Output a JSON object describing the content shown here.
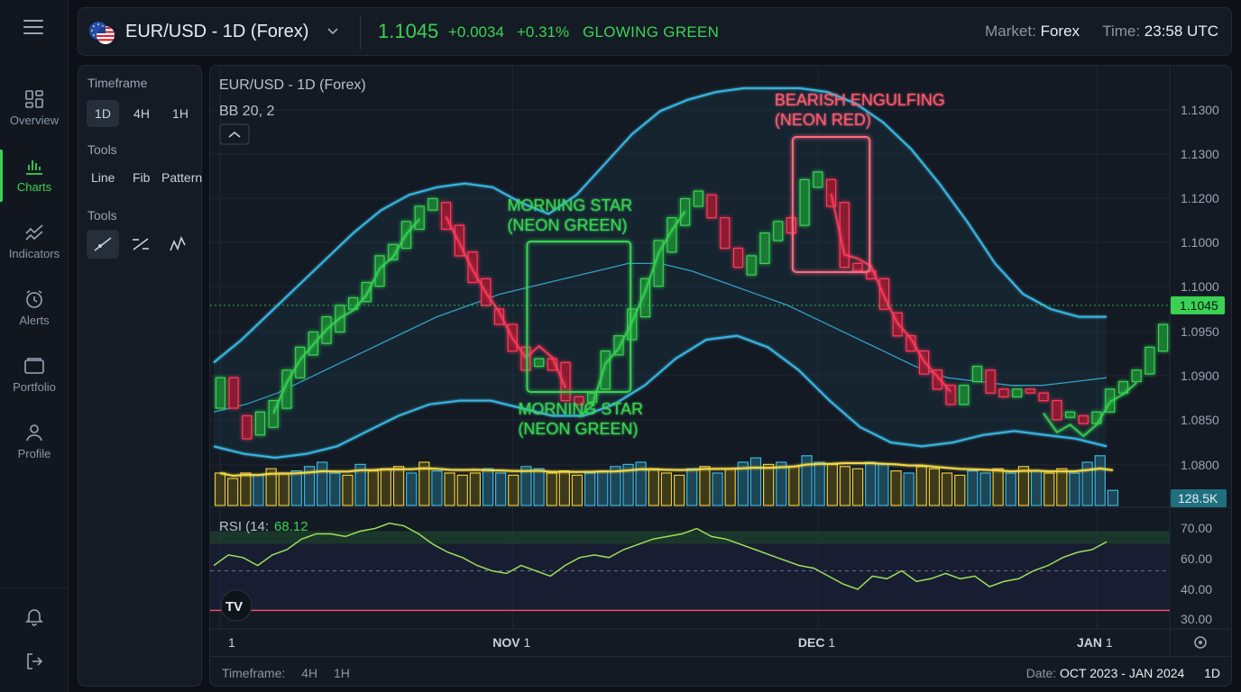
{
  "nav": {
    "items": [
      {
        "id": "overview",
        "label": "Overview",
        "icon": "layout-grid-icon"
      },
      {
        "id": "charts",
        "label": "Charts",
        "icon": "bar-chart-icon"
      },
      {
        "id": "indicators",
        "label": "Indicators",
        "icon": "trend-lines-icon"
      },
      {
        "id": "alerts",
        "label": "Alerts",
        "icon": "alarm-clock-icon"
      },
      {
        "id": "portfolio",
        "label": "Portfolio",
        "icon": "folder-icon"
      },
      {
        "id": "profile",
        "label": "Profile",
        "icon": "user-icon"
      }
    ],
    "active": "charts"
  },
  "header": {
    "pair": "EUR/USD - 1D (Forex)",
    "price": "1.1045",
    "change": "+0.0034",
    "change_pct": "+0.31%",
    "tag": "GLOWING GREEN",
    "market_label": "Market:",
    "market_value": "Forex",
    "time_label": "Time:",
    "time_value": "23:58 UTC"
  },
  "tools_panel": {
    "timeframe_label": "Timeframe",
    "timeframes": [
      "1D",
      "4H",
      "1H"
    ],
    "active_timeframe": "1D",
    "tools_label": "Tools",
    "tools": [
      "Line",
      "Fib",
      "Pattern"
    ],
    "tools2_label": "Tools",
    "drawing_tools": [
      "trendline-icon",
      "ray-icon",
      "path-icon"
    ]
  },
  "chart_header": {
    "title": "EUR/USD - 1D (Forex)",
    "indicator": "BB 20, 2"
  },
  "footer": {
    "timeframe_label": "Timeframe:",
    "timeframe_options": [
      "4H",
      "1H"
    ],
    "date_label": "Date:",
    "date_value": "OCT 2023 - JAN 2024",
    "interval": "1D"
  },
  "colors": {
    "up": "#39d353",
    "down": "#ff3b5c",
    "band": "#38b6e0",
    "volume_up": "#38b6e0",
    "volume_down": "#e8c93a",
    "rsi": "#9be05a",
    "accent": "#39d353"
  },
  "chart_data": [
    {
      "type": "candlestick",
      "title": "EUR/USD - 1D (Forex)",
      "subtitle": "BB 20, 2",
      "x_ticks": [
        {
          "label": "1",
          "index": 0
        },
        {
          "label": "NOV 1",
          "index": 22
        },
        {
          "label": "DEC 1",
          "index": 45
        },
        {
          "label": "JAN 1",
          "index": 66
        }
      ],
      "y_ticks": [
        1.13,
        1.13,
        1.12,
        1.1,
        1.1,
        1.095,
        1.09,
        1.085,
        1.08
      ],
      "y_ticks_display": [
        "1.1300",
        "1.1300",
        "1.1200",
        "1.1000",
        "1.1000",
        "1.0950",
        "1.0900",
        "1.0850",
        "1.0800"
      ],
      "ylim": [
        1.078,
        1.135
      ],
      "last_price_label": "1.1045",
      "volume_label": "128.5K",
      "candles": [
        [
          1.091,
          1.095,
          1.0895,
          1.096
        ],
        [
          1.095,
          1.091,
          1.09,
          1.096
        ],
        [
          1.09,
          1.087,
          1.086,
          1.091
        ],
        [
          1.0875,
          1.0905,
          1.0865,
          1.0915
        ],
        [
          1.0885,
          1.092,
          1.087,
          1.093
        ],
        [
          1.091,
          1.096,
          1.09,
          1.097
        ],
        [
          1.095,
          1.099,
          1.094,
          1.1
        ],
        [
          1.098,
          1.101,
          1.096,
          1.102
        ],
        [
          1.0995,
          1.103,
          1.098,
          1.104
        ],
        [
          1.101,
          1.1045,
          1.0995,
          1.105
        ],
        [
          1.104,
          1.1055,
          1.102,
          1.1065
        ],
        [
          1.105,
          1.1075,
          1.1035,
          1.1085
        ],
        [
          1.107,
          1.111,
          1.106,
          1.112
        ],
        [
          1.1105,
          1.1125,
          1.109,
          1.114
        ],
        [
          1.112,
          1.1155,
          1.11,
          1.1165
        ],
        [
          1.1145,
          1.1175,
          1.113,
          1.1205
        ],
        [
          1.117,
          1.1185,
          1.115,
          1.1195
        ],
        [
          1.118,
          1.1145,
          1.112,
          1.119
        ],
        [
          1.115,
          1.111,
          1.11,
          1.116
        ],
        [
          1.1115,
          1.1075,
          1.106,
          1.112
        ],
        [
          1.108,
          1.1045,
          1.103,
          1.109
        ],
        [
          1.104,
          1.102,
          1.101,
          1.1055
        ],
        [
          1.102,
          1.0985,
          1.097,
          1.103
        ],
        [
          1.099,
          1.096,
          1.0935,
          1.1
        ],
        [
          1.0965,
          1.0975,
          1.094,
          1.099
        ],
        [
          1.0975,
          1.096,
          1.0945,
          1.099
        ],
        [
          1.097,
          1.092,
          1.091,
          1.098
        ],
        [
          1.0925,
          1.0915,
          1.09,
          1.0935
        ],
        [
          1.0918,
          1.093,
          1.0895,
          1.094
        ],
        [
          1.0935,
          1.0985,
          1.0925,
          1.0995
        ],
        [
          1.098,
          1.1005,
          1.097,
          1.1015
        ],
        [
          1.1,
          1.104,
          1.099,
          1.105
        ],
        [
          1.103,
          1.108,
          1.102,
          1.109
        ],
        [
          1.107,
          1.113,
          1.106,
          1.114
        ],
        [
          1.1115,
          1.116,
          1.11,
          1.117
        ],
        [
          1.115,
          1.1185,
          1.114,
          1.1215
        ],
        [
          1.1175,
          1.1195,
          1.116,
          1.12
        ],
        [
          1.119,
          1.116,
          1.115,
          1.12
        ],
        [
          1.116,
          1.112,
          1.111,
          1.117
        ],
        [
          1.112,
          1.1095,
          1.108,
          1.113
        ],
        [
          1.1085,
          1.111,
          1.1075,
          1.112
        ],
        [
          1.11,
          1.114,
          1.109,
          1.115
        ],
        [
          1.113,
          1.1155,
          1.1115,
          1.1175
        ],
        [
          1.116,
          1.114,
          1.113,
          1.1185
        ],
        [
          1.115,
          1.121,
          1.114,
          1.123
        ],
        [
          1.12,
          1.122,
          1.117,
          1.126
        ],
        [
          1.121,
          1.1175,
          1.1165,
          1.122
        ],
        [
          1.118,
          1.1095,
          1.1085,
          1.1185
        ],
        [
          1.11,
          1.109,
          1.106,
          1.111
        ],
        [
          1.109,
          1.108,
          1.106,
          1.11
        ],
        [
          1.108,
          1.104,
          1.103,
          1.109
        ],
        [
          1.1035,
          1.1005,
          1.0985,
          1.105
        ],
        [
          1.1005,
          1.0985,
          1.096,
          1.102
        ],
        [
          1.0985,
          1.0955,
          1.094,
          1.0995
        ],
        [
          1.096,
          1.0935,
          1.092,
          1.097
        ],
        [
          1.094,
          1.0915,
          1.089,
          1.095
        ],
        [
          1.0915,
          1.094,
          1.0875,
          1.0955
        ],
        [
          1.0945,
          1.0965,
          1.093,
          1.0975
        ],
        [
          1.096,
          1.093,
          1.0925,
          1.0965
        ],
        [
          1.0935,
          1.0925,
          1.0915,
          1.0945
        ],
        [
          1.0925,
          1.0935,
          1.091,
          1.0945
        ],
        [
          1.0935,
          1.093,
          1.092,
          1.0955
        ],
        [
          1.093,
          1.092,
          1.0905,
          1.094
        ],
        [
          1.092,
          1.0895,
          1.0885,
          1.0925
        ],
        [
          1.0898,
          1.0905,
          1.088,
          1.091
        ],
        [
          1.09,
          1.089,
          1.0875,
          1.0905
        ],
        [
          1.089,
          1.0905,
          1.088,
          1.0915
        ],
        [
          1.0905,
          1.0935,
          1.0895,
          1.0945
        ],
        [
          1.093,
          1.0945,
          1.092,
          1.0955
        ],
        [
          1.0945,
          1.096,
          1.093,
          1.097
        ],
        [
          1.0955,
          1.099,
          1.0945,
          1.1
        ],
        [
          1.0985,
          1.102,
          1.097,
          1.106
        ]
      ],
      "bb_upper": [
        1.097,
        1.1,
        1.1035,
        1.107,
        1.1105,
        1.114,
        1.117,
        1.119,
        1.12,
        1.1205,
        1.12,
        1.118,
        1.1165,
        1.119,
        1.123,
        1.127,
        1.13,
        1.1315,
        1.1325,
        1.133,
        1.133,
        1.133,
        1.1325,
        1.131,
        1.1285,
        1.125,
        1.1205,
        1.1155,
        1.11,
        1.106,
        1.104,
        1.103,
        1.103
      ],
      "bb_middle": [
        1.0905,
        1.0915,
        1.093,
        1.095,
        1.097,
        1.099,
        1.101,
        1.103,
        1.1045,
        1.106,
        1.107,
        1.108,
        1.109,
        1.11,
        1.11,
        1.109,
        1.1075,
        1.106,
        1.1045,
        1.1025,
        1.1005,
        1.0985,
        1.0965,
        1.095,
        1.0945,
        1.094,
        1.094,
        1.0945,
        1.095
      ],
      "bb_lower": [
        1.086,
        1.085,
        1.0845,
        1.085,
        1.086,
        1.088,
        1.09,
        1.0915,
        1.092,
        1.092,
        1.091,
        1.09,
        1.09,
        1.0915,
        1.094,
        1.0975,
        1.1,
        1.1005,
        1.099,
        1.096,
        1.092,
        1.0885,
        1.0865,
        1.086,
        1.0865,
        1.0875,
        1.088,
        1.0875,
        1.087,
        1.086
      ],
      "volumes": [
        30,
        25,
        30,
        28,
        34,
        30,
        32,
        36,
        40,
        30,
        28,
        38,
        32,
        34,
        36,
        30,
        40,
        32,
        30,
        28,
        30,
        34,
        30,
        28,
        36,
        34,
        30,
        32,
        28,
        30,
        32,
        36,
        38,
        40,
        34,
        30,
        28,
        34,
        36,
        30,
        34,
        40,
        44,
        38,
        40,
        36,
        46,
        40,
        38,
        36,
        34,
        40,
        38,
        32,
        30,
        36,
        34,
        30,
        28,
        32,
        30,
        34,
        30,
        36,
        32,
        30,
        34,
        30,
        40,
        46,
        14
      ],
      "volume_up_flags": [
        0,
        0,
        0,
        1,
        0,
        0,
        1,
        1,
        1,
        1,
        0,
        1,
        0,
        0,
        0,
        1,
        0,
        1,
        0,
        0,
        0,
        1,
        1,
        0,
        1,
        1,
        0,
        0,
        0,
        1,
        1,
        1,
        1,
        1,
        0,
        0,
        0,
        1,
        0,
        1,
        0,
        1,
        1,
        0,
        1,
        0,
        1,
        1,
        0,
        0,
        0,
        1,
        1,
        0,
        1,
        0,
        0,
        0,
        0,
        1,
        1,
        0,
        1,
        0,
        1,
        0,
        0,
        1,
        1,
        1,
        1
      ],
      "annotations": [
        {
          "text_line1": "MORNING STAR",
          "text_line2": "(NEON GREEN)",
          "kind": "bullish",
          "start": 24,
          "end": 30
        },
        {
          "text_line1": "MORNING STAR",
          "text_line2": "(NEON GREEN)",
          "kind": "bullish-bottom",
          "start": 24,
          "end": 30
        },
        {
          "text_line1": "BEARISH ENGULFING",
          "text_line2": "(NEON RED)",
          "kind": "bearish",
          "start": 44,
          "end": 48
        }
      ]
    },
    {
      "type": "line",
      "title": "RSI (14:",
      "value_label": "68.12",
      "y_ticks_display": [
        "70.00",
        "60.00",
        "40.00",
        "30.00"
      ],
      "ylim": [
        28,
        72
      ],
      "overbought": 65,
      "oversold": 35,
      "midline": 50,
      "values": [
        52,
        56,
        55,
        52,
        56,
        58,
        62,
        64,
        64,
        63,
        65,
        66,
        68,
        67,
        64,
        60,
        57,
        55,
        52,
        50,
        49,
        52,
        50,
        48,
        52,
        55,
        56,
        55,
        58,
        60,
        62,
        63,
        64,
        66,
        63,
        62,
        60,
        58,
        56,
        54,
        52,
        51,
        48,
        45,
        43,
        48,
        47,
        50,
        46,
        47,
        49,
        47,
        48,
        44,
        46,
        47,
        50,
        52,
        55,
        57,
        58,
        61
      ]
    }
  ]
}
